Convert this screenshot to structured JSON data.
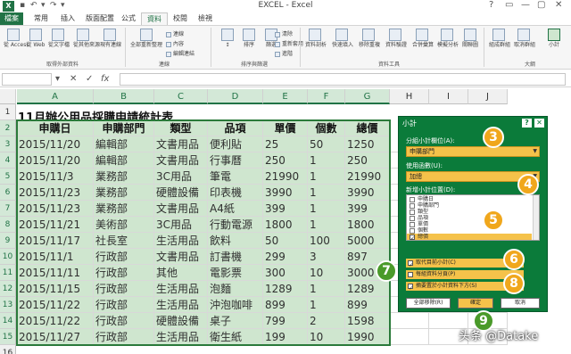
{
  "window": {
    "title": "EXCEL - Excel",
    "app_icon_label": "X",
    "qat": [
      "↶",
      "↷",
      "▾"
    ],
    "controls": [
      "?",
      "▭",
      "—",
      "▢",
      "✕"
    ]
  },
  "tabs": [
    "檔案",
    "常用",
    "插入",
    "版面配置",
    "公式",
    "資料",
    "校閱",
    "檢視"
  ],
  "active_tab": "資料",
  "ribbon": {
    "get_external": {
      "buttons": [
        "從 Access",
        "從 Web",
        "從文字檔",
        "從其他來源",
        "現有連線"
      ],
      "group_label": "取得外部資料"
    },
    "connections": {
      "button": "全部重新整理",
      "small": [
        "連線",
        "內容",
        "編輯連結"
      ],
      "group_label": "連線"
    },
    "sort_filter": {
      "buttons": [
        "排序",
        "篩選"
      ],
      "small": [
        "清除",
        "重新套用",
        "進階"
      ],
      "group_label": "排序與篩選"
    },
    "data_tools": {
      "buttons": [
        "資料剖析",
        "快速填入",
        "移除重複",
        "資料驗證",
        "合併彙算",
        "模擬分析",
        "關聯圖"
      ],
      "group_label": "資料工具"
    },
    "outline": {
      "buttons": [
        "組成群組",
        "取消群組",
        "小計"
      ],
      "group_label": "大綱"
    }
  },
  "formula_bar": {
    "name_box": "",
    "icons": [
      "✕",
      "✓",
      "fx"
    ],
    "content": ""
  },
  "sheet": {
    "columns": [
      "A",
      "B",
      "C",
      "D",
      "E",
      "F",
      "G",
      "H",
      "I",
      "J"
    ],
    "selected_columns": [
      "A",
      "B",
      "C",
      "D",
      "E",
      "F",
      "G"
    ],
    "rows": [
      "1",
      "2",
      "3",
      "4",
      "5",
      "6",
      "7",
      "8",
      "9",
      "10",
      "11",
      "12",
      "13",
      "14",
      "15",
      "16"
    ],
    "title": "11月辦公用品採購申請統計表",
    "headers": [
      "申購日",
      "申購部門",
      "類型",
      "品項",
      "單價",
      "個數",
      "總價"
    ],
    "data": [
      [
        "2015/11/20",
        "編輯部",
        "文書用品",
        "便利貼",
        "25",
        "50",
        "1250"
      ],
      [
        "2015/11/20",
        "編輯部",
        "文書用品",
        "行事曆",
        "250",
        "1",
        "250"
      ],
      [
        "2015/11/3",
        "業務部",
        "3C用品",
        "筆電",
        "21990",
        "1",
        "21990"
      ],
      [
        "2015/11/23",
        "業務部",
        "硬體設備",
        "印表機",
        "3990",
        "1",
        "3990"
      ],
      [
        "2015/11/23",
        "業務部",
        "文書用品",
        "A4紙",
        "399",
        "1",
        "399"
      ],
      [
        "2015/11/21",
        "美術部",
        "3C用品",
        "行動電源",
        "1800",
        "1",
        "1800"
      ],
      [
        "2015/11/17",
        "社長室",
        "生活用品",
        "飲料",
        "50",
        "100",
        "5000"
      ],
      [
        "2015/11/1",
        "行政部",
        "文書用品",
        "訂書機",
        "299",
        "3",
        "897"
      ],
      [
        "2015/11/11",
        "行政部",
        "其他",
        "電影票",
        "300",
        "10",
        "3000"
      ],
      [
        "2015/11/15",
        "行政部",
        "生活用品",
        "泡麵",
        "1289",
        "1",
        "1289"
      ],
      [
        "2015/11/22",
        "行政部",
        "生活用品",
        "沖泡咖啡",
        "899",
        "1",
        "899"
      ],
      [
        "2015/11/22",
        "行政部",
        "硬體設備",
        "桌子",
        "799",
        "2",
        "1598"
      ],
      [
        "2015/11/27",
        "行政部",
        "生活用品",
        "衛生紙",
        "199",
        "10",
        "1990"
      ]
    ]
  },
  "dialog": {
    "title": "小計",
    "help": "?",
    "close": "✕",
    "group_by_label": "分組小計欄位(A):",
    "group_by_value": "申購部門",
    "function_label": "使用函數(U):",
    "function_value": "加總",
    "add_to_label": "新增小計位置(D):",
    "list": [
      {
        "label": "申購日",
        "checked": false
      },
      {
        "label": "申購部門",
        "checked": false
      },
      {
        "label": "類型",
        "checked": false
      },
      {
        "label": "品項",
        "checked": false
      },
      {
        "label": "單價",
        "checked": false
      },
      {
        "label": "個數",
        "checked": false
      },
      {
        "label": "總價",
        "checked": true
      }
    ],
    "options": [
      {
        "label": "取代目前小計(C)",
        "checked": true
      },
      {
        "label": "每組資料分頁(P)",
        "checked": false
      },
      {
        "label": "摘要置於小計資料下方(S)",
        "checked": true
      }
    ],
    "buttons": {
      "remove_all": "全部移除(R)",
      "ok": "確定",
      "cancel": "取消"
    }
  },
  "badges": [
    "3",
    "4",
    "5",
    "6",
    "7",
    "8",
    "9"
  ],
  "watermark": "头条 @Datake",
  "colors": {
    "excel_green": "#217346",
    "dialog_green": "#0b7b3a",
    "highlight_orange": "#f5c24a",
    "badge_orange": "#f0a71c",
    "badge_green": "#4a9a2a",
    "cell_green": "#cfe6cf"
  }
}
